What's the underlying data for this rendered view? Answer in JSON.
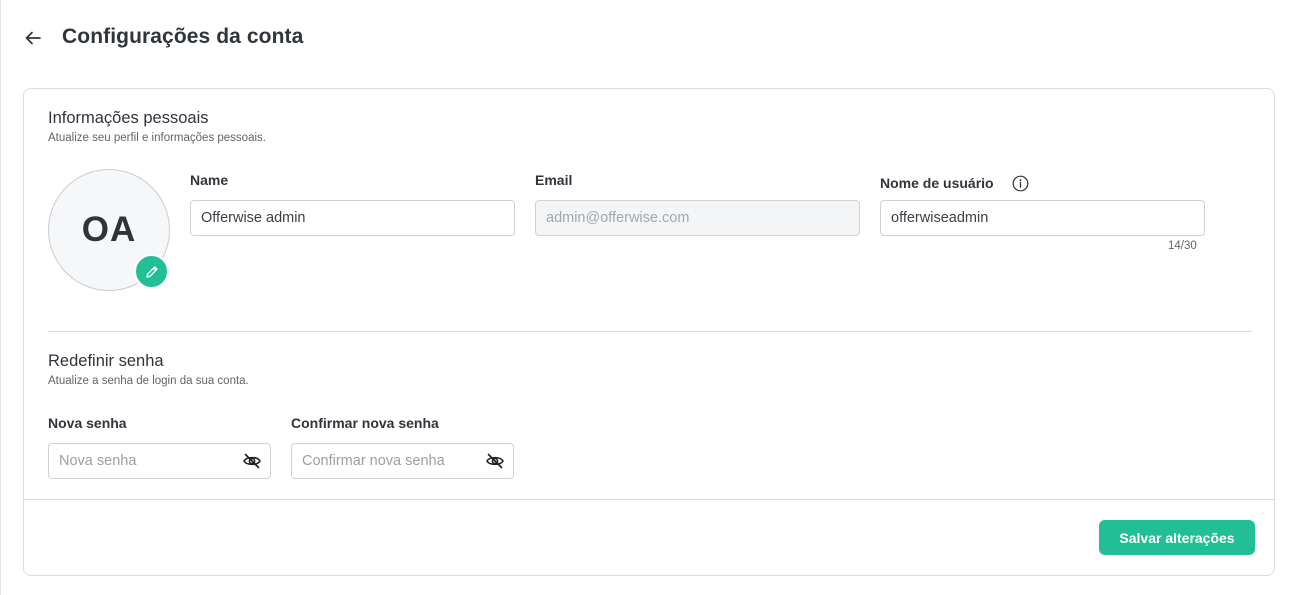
{
  "header": {
    "title": "Configurações da conta",
    "back_icon": "arrow-left-icon"
  },
  "personal": {
    "title": "Informações pessoais",
    "subtitle": "Atualize seu perfil e informações pessoais.",
    "avatar_initials": "OA",
    "name": {
      "label": "Name",
      "value": "Offerwise admin"
    },
    "email": {
      "label": "Email",
      "value": "admin@offerwise.com"
    },
    "username": {
      "label": "Nome de usuário",
      "value": "offerwiseadmin",
      "counter": "14/30"
    }
  },
  "password": {
    "title": "Redefinir senha",
    "subtitle": "Atualize a senha de login da sua conta.",
    "new": {
      "label": "Nova senha",
      "placeholder": "Nova senha"
    },
    "confirm": {
      "label": "Confirmar nova senha",
      "placeholder": "Confirmar nova senha"
    }
  },
  "footer": {
    "save_label": "Salvar alterações"
  },
  "colors": {
    "accent": "#22bf97",
    "text": "#30343b",
    "border": "#d9dce0"
  }
}
